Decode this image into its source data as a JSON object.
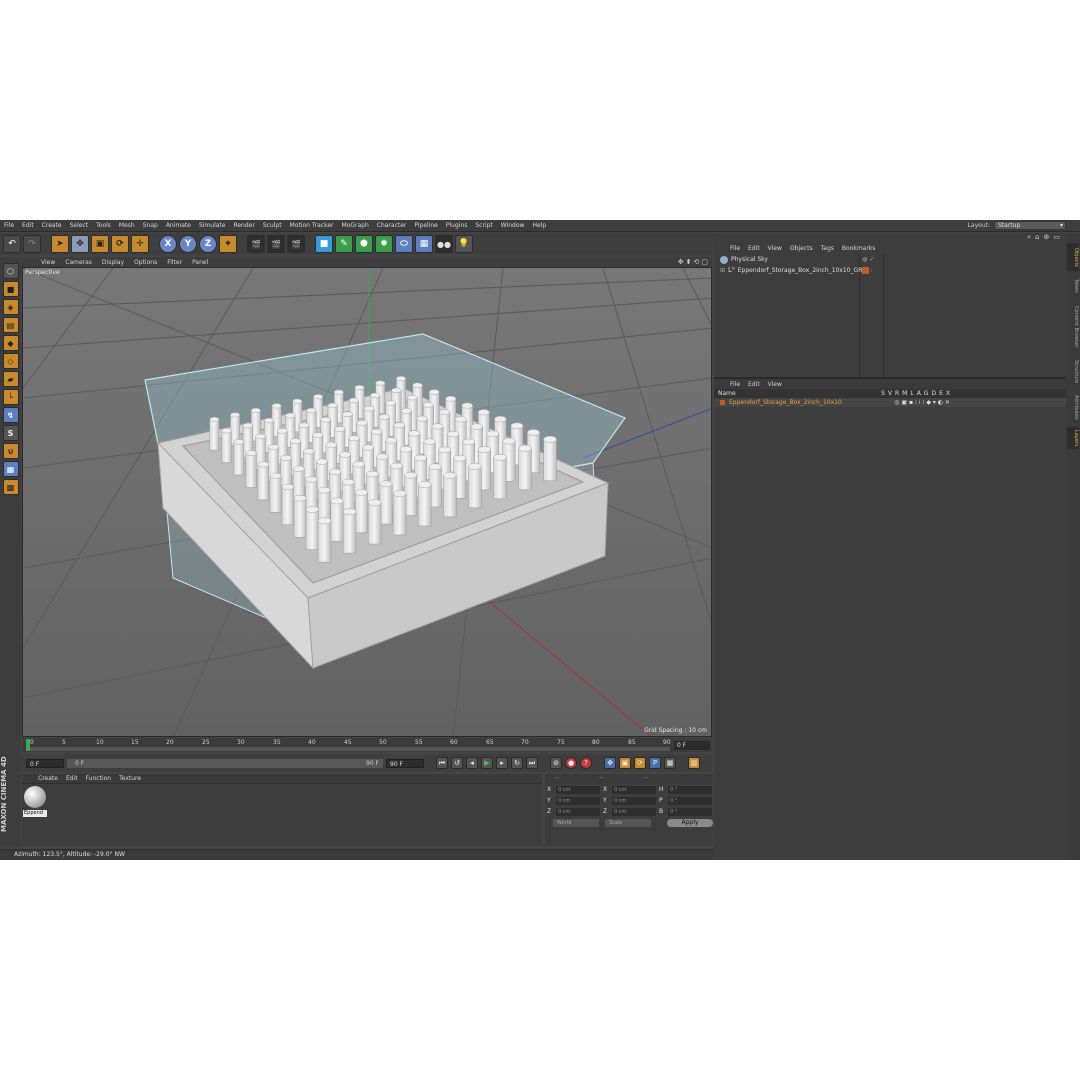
{
  "menubar": {
    "items": [
      "File",
      "Edit",
      "Create",
      "Select",
      "Tools",
      "Mesh",
      "Snap",
      "Animate",
      "Simulate",
      "Render",
      "Sculpt",
      "Motion Tracker",
      "MoGraph",
      "Character",
      "Pipeline",
      "Plugins",
      "Script",
      "Window",
      "Help"
    ],
    "layout_label": "Layout:",
    "layout_value": "Startup"
  },
  "toolbar": {
    "undo_icon": "undo-icon",
    "x_label": "X",
    "y_label": "Y",
    "z_label": "Z"
  },
  "viewport": {
    "menu": [
      "View",
      "Cameras",
      "Display",
      "Options",
      "Filter",
      "Panel"
    ],
    "label": "Perspective",
    "grid_spacing": "Grid Spacing : 10 cm"
  },
  "timeline": {
    "ticks": [
      "0",
      "5",
      "10",
      "15",
      "20",
      "25",
      "30",
      "35",
      "40",
      "45",
      "50",
      "55",
      "60",
      "65",
      "70",
      "75",
      "80",
      "85",
      "90"
    ],
    "current": "0 F"
  },
  "transport": {
    "start_field": "0 F",
    "slider_start": "0 F",
    "slider_end": "90 F",
    "end_field": "90 F"
  },
  "materials": {
    "menu": [
      "Create",
      "Edit",
      "Function",
      "Texture"
    ],
    "items": [
      {
        "name": "Eppend"
      }
    ]
  },
  "brand": "MAXON CINEMA 4D",
  "coordinates": {
    "head": [
      "--",
      "--",
      "--"
    ],
    "rows": [
      {
        "a": "X",
        "av": "0 cm",
        "b": "X",
        "bv": "0 cm",
        "c": "H",
        "cv": "0 °"
      },
      {
        "a": "Y",
        "av": "0 cm",
        "b": "Y",
        "bv": "0 cm",
        "c": "P",
        "cv": "0 °"
      },
      {
        "a": "Z",
        "av": "0 cm",
        "b": "Z",
        "bv": "0 cm",
        "c": "B",
        "cv": "0 °"
      }
    ],
    "mode_world": "World",
    "mode_scale": "Scale",
    "apply_label": "Apply"
  },
  "status": "Azimuth: 123.5°, Altitude: -29.0°  NW",
  "objects_panel": {
    "menu": [
      "File",
      "Edit",
      "View",
      "Objects",
      "Tags",
      "Bookmarks"
    ],
    "rows": [
      {
        "name": "Physical Sky"
      },
      {
        "name": "Eppendorf_Storage_Box_2inch_10x10_GRP"
      }
    ]
  },
  "attributes_panel": {
    "menu": [
      "File",
      "Edit",
      "View"
    ],
    "header_name": "Name",
    "header_cols": [
      "S",
      "V",
      "R",
      "M",
      "L",
      "A",
      "G",
      "D",
      "E",
      "X"
    ],
    "row_name": "Eppendorf_Storage_Box_2inch_10x10"
  },
  "right_tabs": [
    "Objects",
    "Takes",
    "Content Browser",
    "Structure",
    "Attributes",
    "Layers"
  ],
  "colors": {
    "accent": "#e8a23c",
    "tag": "#c05a28",
    "bg": "#444444",
    "viewport": "#6a6a6a"
  }
}
